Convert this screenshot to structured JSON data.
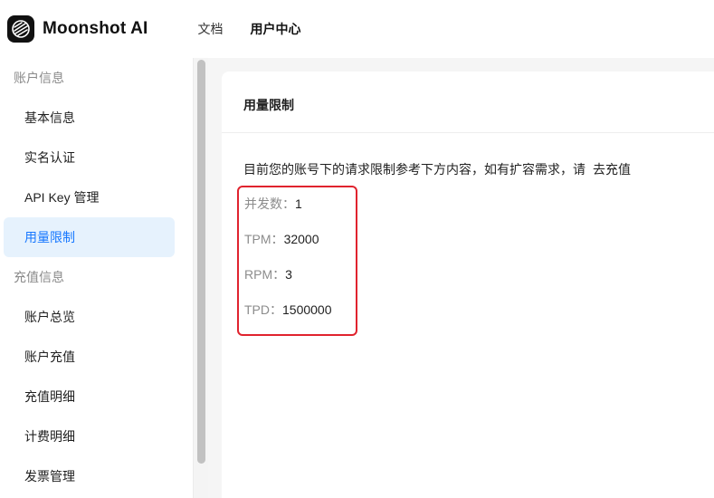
{
  "header": {
    "brand": "Moonshot AI",
    "nav": [
      {
        "label": "文档"
      },
      {
        "label": "用户中心"
      }
    ]
  },
  "sidebar": {
    "groups": [
      {
        "title": "账户信息",
        "items": [
          {
            "label": "基本信息"
          },
          {
            "label": "实名认证"
          },
          {
            "label": "API Key 管理"
          },
          {
            "label": "用量限制"
          }
        ]
      },
      {
        "title": "充值信息",
        "items": [
          {
            "label": "账户总览"
          },
          {
            "label": "账户充值"
          },
          {
            "label": "充值明细"
          },
          {
            "label": "计费明细"
          },
          {
            "label": "发票管理"
          }
        ]
      }
    ]
  },
  "main": {
    "title": "用量限制",
    "description": "目前您的账号下的请求限制参考下方内容，如有扩容需求，请",
    "recharge_link": "去充值",
    "limits": [
      {
        "label": "并发数：",
        "value": "1"
      },
      {
        "label": "TPM：",
        "value": "32000"
      },
      {
        "label": "RPM：",
        "value": "3"
      },
      {
        "label": "TPD：",
        "value": "1500000"
      }
    ]
  },
  "colors": {
    "accent": "#1677ff",
    "active_bg": "#e6f2fd",
    "highlight": "#e0232e"
  }
}
